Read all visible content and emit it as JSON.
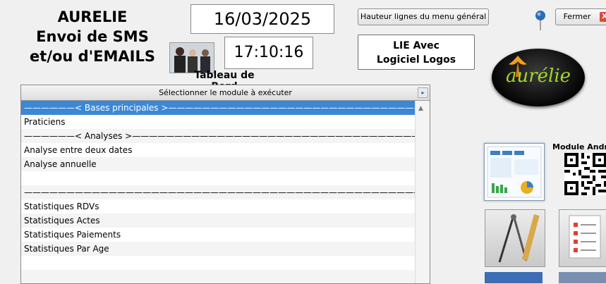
{
  "header": {
    "title_line1": "AURELIE",
    "title_line2": "Envoi de SMS",
    "title_line3": "et/ou d'EMAILS",
    "date": "16/03/2025",
    "time": "17:10:16",
    "dashboard_label": "Tableau de Bord"
  },
  "buttons": {
    "menu_height": "Hauteur lignes du menu général",
    "close": "Fermer",
    "close_x": "X"
  },
  "lie": {
    "line1": "LIE Avec",
    "line2": "Logiciel Logos"
  },
  "logo": {
    "text": "aurélie"
  },
  "panel": {
    "header": "Sélectionner le module à exécuter",
    "arrow": "▸",
    "rows": [
      "——————< Bases principales >—————————————————————————————————————————————————",
      "Praticiens",
      "——————< Analyses >—————————————————————————————————————————————————————————",
      "Analyse entre deux dates",
      "Analyse annuelle",
      "",
      "———————————————————————————————————————————————————————————————————————————",
      "Statistiques RDVs",
      "Statistiques Actes",
      "Statistiques Paiements",
      "Statistiques Par Age",
      "",
      "",
      ""
    ]
  },
  "right": {
    "android_label": "Module Android"
  },
  "colors": {
    "selection": "#3c87d6",
    "logo_green": "#a2d72a",
    "close_red": "#d64b3b"
  }
}
